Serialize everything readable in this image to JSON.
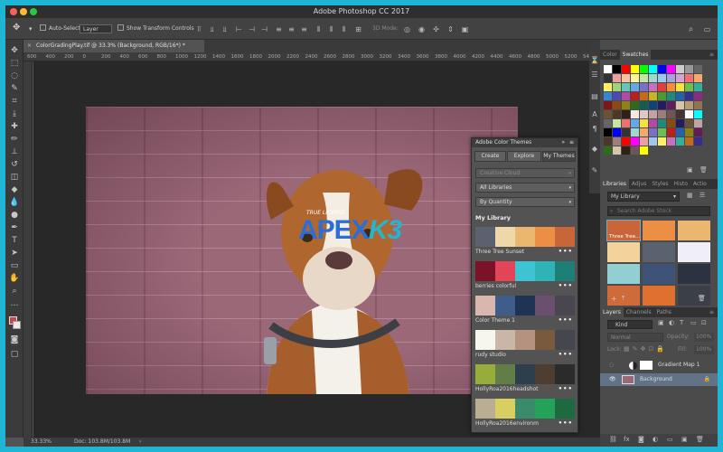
{
  "window": {
    "title": "Adobe Photoshop CC 2017"
  },
  "options_bar": {
    "auto_select_label": "Auto-Select:",
    "auto_select_value": "Layer",
    "transform_label": "Show Transform Controls",
    "mode_label": "3D Mode:"
  },
  "document": {
    "tab_title": "ColorGradingPlay.tif @ 33.3% (Background, RGB/16*) *"
  },
  "ruler": {
    "ticks": [
      "600",
      "400",
      "200",
      "0",
      "200",
      "400",
      "600",
      "800",
      "1000",
      "1200",
      "1400",
      "1600",
      "1800",
      "2000",
      "2200",
      "2400",
      "2600",
      "2800",
      "3000",
      "3200",
      "3400",
      "3600",
      "3800",
      "4000",
      "4200",
      "4400",
      "4600",
      "4800",
      "5000",
      "5200",
      "5400"
    ]
  },
  "watermark": {
    "sub": "TRUE LICENSE",
    "main1": "APEX",
    "main2": "K3"
  },
  "status": {
    "zoom": "33.33%",
    "doc": "Doc: 103.8M/103.8M"
  },
  "color_panel": {
    "tabs": [
      "Color",
      "Swatches"
    ],
    "swatches": [
      "#ffffff",
      "#000000",
      "#ff0000",
      "#ffff00",
      "#00ff00",
      "#00ffff",
      "#0000ff",
      "#ff00ff",
      "#cccccc",
      "#999999",
      "#666666",
      "#333333",
      "#e9a0a0",
      "#f4c49c",
      "#fff3a0",
      "#c5e6a2",
      "#a0d8d0",
      "#9fc8ef",
      "#a8a3d8",
      "#d7a3d1",
      "#f07070",
      "#f7a96b",
      "#fff066",
      "#9ed47c",
      "#66c7b8",
      "#66a7e6",
      "#7a70c8",
      "#c870bb",
      "#e53d3d",
      "#f38d3b",
      "#f5e23c",
      "#6fbf4f",
      "#33b09c",
      "#3385d6",
      "#5148b2",
      "#b04aa4",
      "#b81f1f",
      "#c46a1d",
      "#c7b51f",
      "#4a9a32",
      "#1f8a7a",
      "#1f63ad",
      "#362e8a",
      "#8a2d80",
      "#821515",
      "#8c4a12",
      "#8f8214",
      "#2f6b1f",
      "#125e53",
      "#12427a",
      "#231c61",
      "#611d5a",
      "#d8c4a8",
      "#b89c7a",
      "#8f7353",
      "#6b5139",
      "#4d3827",
      "#2e2117",
      "#f6e7e0",
      "#e2c8c4",
      "#c3a3a0",
      "#9b7d7b",
      "#6d5655",
      "#433433"
    ],
    "tooltip_icons": [
      "trash-icon"
    ]
  },
  "libraries": {
    "tabs": [
      "Libraries",
      "Adjus",
      "Styles",
      "Histo",
      "Actio"
    ],
    "library_name": "My Library",
    "search_placeholder": "Search Adobe Stock",
    "featured_name": "Three Tree...",
    "swatches": [
      "#c8663a",
      "#ec8e44",
      "#eab670",
      "#f3d29c",
      "#5a6270",
      "#f0eef6",
      "#93cfd2",
      "#3f5278",
      "#2c3240",
      "#cf6b3b",
      "#e07030",
      "#3b3f48"
    ]
  },
  "layers": {
    "tabs": [
      "Layers",
      "Channels",
      "Paths"
    ],
    "kind": "Kind",
    "blend_mode": "Normal",
    "opacity_label": "Opacity:",
    "opacity_value": "100%",
    "lock_label": "Lock:",
    "fill_label": "Fill:",
    "fill_value": "100%",
    "items": [
      {
        "name": "Gradient Map 1"
      },
      {
        "name": "Background"
      }
    ]
  },
  "color_themes": {
    "title": "Adobe Color Themes",
    "tabs": [
      "Create",
      "Explore",
      "My Themes"
    ],
    "source": "Creative Cloud",
    "library_filter": "All Libraries",
    "sort": "By Quantity",
    "section": "My Library",
    "themes": [
      {
        "name": "Three Tree Sunset",
        "colors": [
          "#5a6270",
          "#eed7a8",
          "#eab670",
          "#ec8e44",
          "#c8663a"
        ]
      },
      {
        "name": "berries colorful",
        "colors": [
          "#7a1228",
          "#e14557",
          "#3ec3d5",
          "#2fb3b7",
          "#1d7f75"
        ]
      },
      {
        "name": "Color Theme 1",
        "colors": [
          "#d9b7ae",
          "#405c8a",
          "#1f3355",
          "#6a4f6f",
          "#4a4650"
        ]
      },
      {
        "name": "rudy studio",
        "colors": [
          "#f7f6ee",
          "#c9b6a7",
          "#b59280",
          "#7a5a3e",
          "#444650"
        ]
      },
      {
        "name": "HollyRoa2016headshot",
        "colors": [
          "#97ad3b",
          "#627d45",
          "#2d3e4c",
          "#4d3e31",
          "#2b2b2b"
        ]
      },
      {
        "name": "HollyRoa2016environm",
        "colors": [
          "#b9ae94",
          "#d8cf62",
          "#3a8a6c",
          "#25a259",
          "#1d6a40"
        ]
      }
    ]
  }
}
